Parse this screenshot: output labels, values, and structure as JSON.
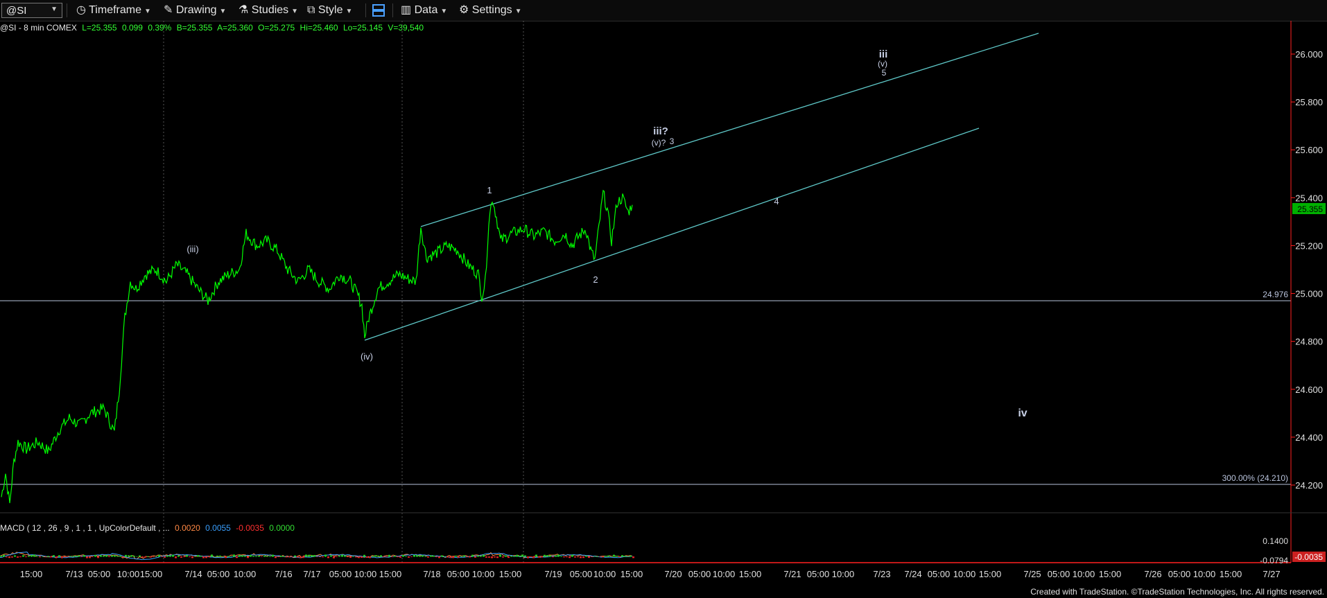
{
  "toolbar": {
    "symbol": "@SI",
    "timeframe_label": "Timeframe",
    "drawing_label": "Drawing",
    "studies_label": "Studies",
    "style_label": "Style",
    "data_label": "Data",
    "settings_label": "Settings"
  },
  "quote": {
    "symbol_info": "@SI - 8 min  COMEX",
    "last": "L=25.355",
    "change": "0.099",
    "change_pct": "0.39%",
    "bid": "B=25.355",
    "ask": "A=25.360",
    "open": "O=25.275",
    "high": "Hi=25.460",
    "low": "Lo=25.145",
    "volume": "V=39,540"
  },
  "macd": {
    "label": "MACD ( 12 , 26 , 9 , 1 , 1 , UpColorDefault , ...",
    "v1": "0.0020",
    "v2": "0.0055",
    "v3": "-0.0035",
    "v4": "0.0000",
    "axis_top": "0.1400",
    "axis_low": "-0.0794",
    "current": "-0.0035"
  },
  "price_axis": {
    "ticks": [
      "26.000",
      "25.800",
      "25.600",
      "25.400",
      "25.200",
      "25.000",
      "24.800",
      "24.600",
      "24.400",
      "24.200"
    ],
    "last_price": "25.355"
  },
  "horizontal_lines": {
    "level1_label": "24.976",
    "level2_label": "300.00% (24.210)"
  },
  "wave_labels": {
    "iii_small": "(iii)",
    "iv_small": "(iv)",
    "one": "1",
    "two": "2",
    "iii_q": "iii?",
    "v_q": "(v)?",
    "three": "3",
    "four": "4",
    "iii_big": "iii",
    "v_big": "(v)",
    "five": "5",
    "iv_big": "iv"
  },
  "time_axis": [
    "15:00",
    "7/13",
    "05:00",
    "10:00",
    "15:00",
    "7/14",
    "05:00",
    "10:00",
    "7/16",
    "7/17",
    "05:00",
    "10:00",
    "15:00",
    "7/18",
    "05:00",
    "10:00",
    "15:00",
    "7/19",
    "05:00",
    "10:00",
    "15:00",
    "7/20",
    "05:00",
    "10:00",
    "15:00",
    "7/21",
    "05:00",
    "10:00",
    "7/23",
    "7/24",
    "05:00",
    "10:00",
    "15:00",
    "7/25",
    "05:00",
    "10:00",
    "15:00",
    "7/26",
    "05:00",
    "10:00",
    "15:00",
    "7/27"
  ],
  "footer": "Created with TradeStation. ©TradeStation Technologies, Inc. All rights reserved.",
  "colors": {
    "price": "#00ff00",
    "channel": "#5fc9c9",
    "axis_highlight": "#ff0000",
    "level_line": "#b9c3dc"
  },
  "chart_data": {
    "type": "line",
    "title": "",
    "ylim": [
      24.1,
      26.2
    ],
    "series": [
      {
        "x": [
          "7/12 15:00",
          "7/13 05:00",
          "7/13 10:00",
          "7/13 15:00",
          "7/14 05:00",
          "7/14 10:00",
          "7/16",
          "7/17 05:00",
          "7/17 10:00",
          "7/17 15:00",
          "7/18",
          "7/18 05:00",
          "7/18 10:00",
          "7/18 15:00",
          "7/19",
          "7/19 05:00",
          "7/19 10:00",
          "7/19 15:00"
        ],
        "values": [
          24.15,
          24.4,
          24.5,
          25.05,
          25.1,
          25.0,
          25.2,
          25.05,
          24.82,
          25.05,
          25.1,
          25.2,
          25.0,
          25.3,
          25.25,
          25.2,
          25.4,
          25.355
        ]
      }
    ]
  }
}
